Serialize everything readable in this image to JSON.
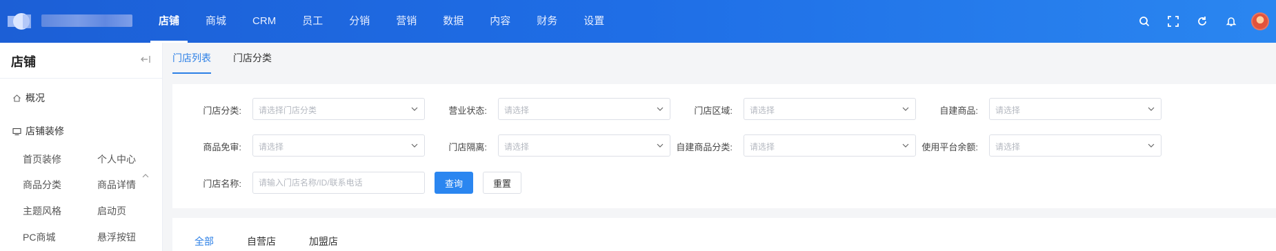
{
  "topnav": {
    "items": [
      "店铺",
      "商城",
      "CRM",
      "员工",
      "分销",
      "营销",
      "数据",
      "内容",
      "财务",
      "设置"
    ],
    "active_index": 0,
    "icons": [
      "search-icon",
      "fullscreen-icon",
      "refresh-icon",
      "bell-icon",
      "avatar"
    ]
  },
  "sidebar": {
    "title": "店铺",
    "overview": "概况",
    "decoration_group": "店铺装修",
    "sub_items": [
      "首页装修",
      "个人中心",
      "商品分类",
      "商品详情",
      "主题风格",
      "启动页",
      "PC商城",
      "悬浮按钮"
    ]
  },
  "subtabs": [
    "门店列表",
    "门店分类"
  ],
  "filters": {
    "row1": [
      {
        "label": "门店分类:",
        "placeholder": "请选择门店分类"
      },
      {
        "label": "营业状态:",
        "placeholder": "请选择"
      },
      {
        "label": "门店区域:",
        "placeholder": "请选择"
      },
      {
        "label": "自建商品:",
        "placeholder": "请选择"
      }
    ],
    "row2": [
      {
        "label": "商品免审:",
        "placeholder": "请选择"
      },
      {
        "label": "门店隔离:",
        "placeholder": "请选择"
      },
      {
        "label": "自建商品分类:",
        "placeholder": "请选择"
      },
      {
        "label": "使用平台余额:",
        "placeholder": "请选择"
      }
    ],
    "name_label": "门店名称:",
    "name_placeholder": "请输入门店名称/ID/联系电话",
    "query_label": "查询",
    "reset_label": "重置"
  },
  "store_tabs": [
    "全部",
    "自营店",
    "加盟店"
  ],
  "colors": {
    "accent": "#2b7fe6",
    "topbar_start": "#1c5fd6",
    "topbar_end": "#2a86f0"
  }
}
